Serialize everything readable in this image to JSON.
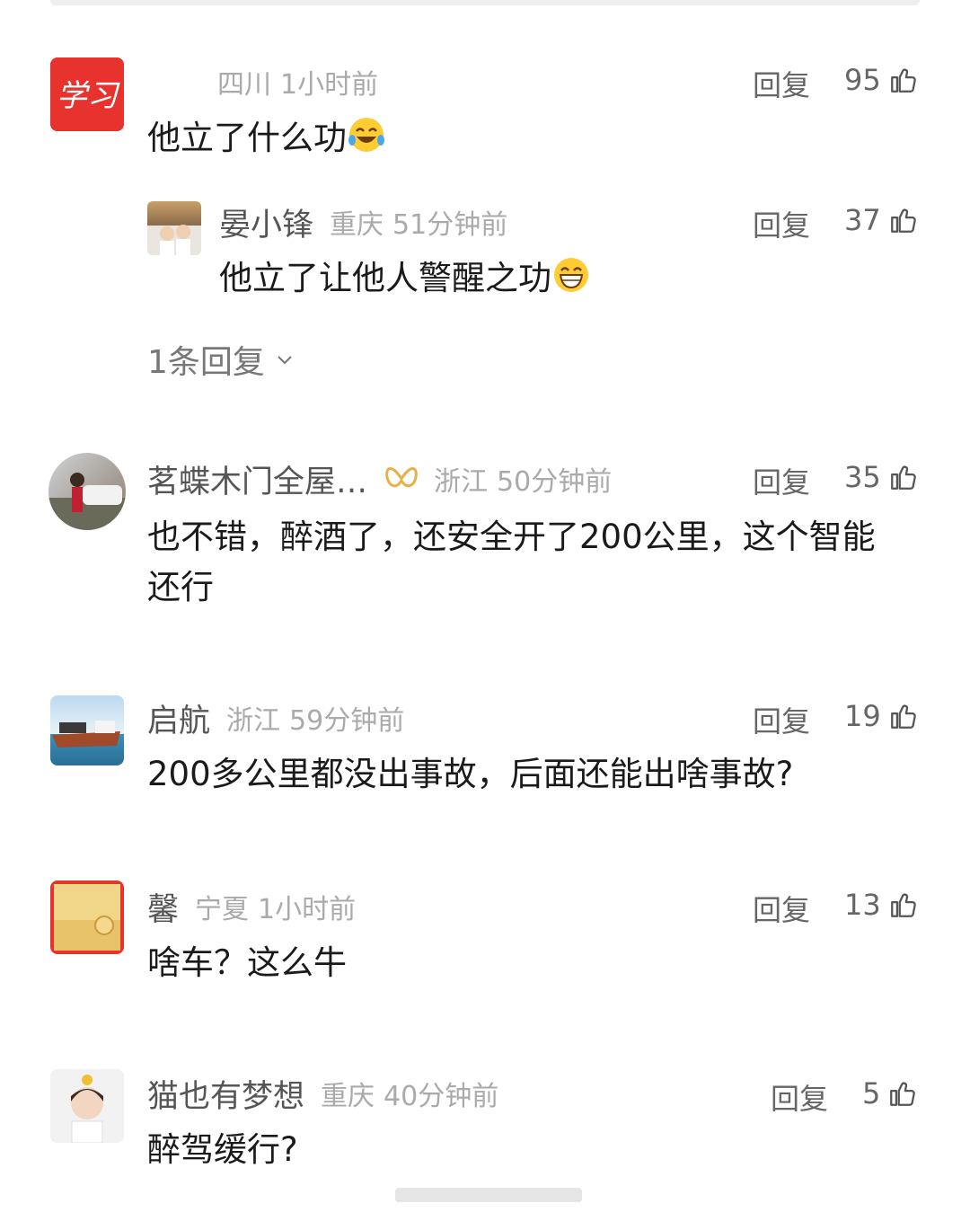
{
  "comments": [
    {
      "username": "",
      "location": "四川",
      "time": "1小时前",
      "reply_label": "回复",
      "likes": "95",
      "text": "他立了什么功",
      "avatar_text": "学习",
      "sub_reply": {
        "username": "晏小锋",
        "location": "重庆",
        "time": "51分钟前",
        "reply_label": "回复",
        "likes": "37",
        "text": "他立了让他人警醒之功"
      },
      "more_replies": "1条回复"
    },
    {
      "username": "茗蝶木门全屋…",
      "location": "浙江",
      "time": "50分钟前",
      "reply_label": "回复",
      "likes": "35",
      "text": "也不错，醉酒了，还安全开了200公里，这个智能还行"
    },
    {
      "username": "启航",
      "location": "浙江",
      "time": "59分钟前",
      "reply_label": "回复",
      "likes": "19",
      "text": "200多公里都没出事故，后面还能出啥事故?"
    },
    {
      "username": "馨",
      "location": "宁夏",
      "time": "1小时前",
      "reply_label": "回复",
      "likes": "13",
      "text": "啥车？这么牛"
    },
    {
      "username": "猫也有梦想",
      "location": "重庆",
      "time": "40分钟前",
      "reply_label": "回复",
      "likes": "5",
      "text": "醉驾缓行?"
    }
  ],
  "icons": {
    "like": "thumbs-up-icon",
    "expand": "chevron-down-icon",
    "emoji_laugh": "tears-of-joy-emoji",
    "emoji_grin": "grinning-emoji",
    "badge": "butterfly-badge-icon"
  },
  "colors": {
    "avatar_red": "#e8322d",
    "text_primary": "#1a1a1a",
    "text_secondary": "#aaaaaa",
    "badge_gold": "#e6b04a"
  }
}
